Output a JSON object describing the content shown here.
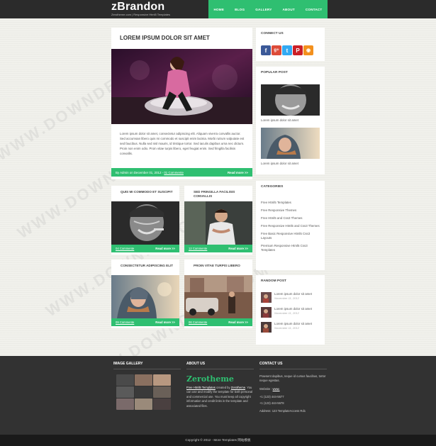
{
  "header": {
    "logo": "zBrandon",
    "tagline": "Zerotheme.com | Responsive Html5 Templates",
    "nav": [
      "HOME",
      "BLOG",
      "GALLERY",
      "ABOUT",
      "CONTACT"
    ]
  },
  "main_post": {
    "title": "LOREM IPSUM DOLOR SIT AMET",
    "image": "woman-on-car-photo",
    "text": "Lorem ipsum dolor sit amet, consectetur adipiscing elit. Aliquam viverra convallis auctor. Sed accumsan libero quis mi commodo et suscipit enim lacinia. Morbi rutrum vulputate est sed faucibus. Nulla sed nisl mauris, id tristique tortor. Sed iaculis dapibus urna nec dictum. Proin non enim odio. Proin vitae turpis libero, eget feugiat enim. Sed fringilla facilisis convallis.",
    "meta_prefix": "By Admin on December 01, 2012 - ",
    "comments": "01 Commente",
    "readmore": "Read more >>"
  },
  "small_posts": [
    {
      "title": "QUIS MI COMMODO ET SUSCIPIT",
      "comments": "04 Commente",
      "readmore": "Read more >>"
    },
    {
      "title": "SED FRINGILLA FACILISIS CONVALLIS",
      "comments": "12 Commente",
      "readmore": "Read more >>"
    },
    {
      "title": "CONSECTETUR ADIPISCING ELIT",
      "comments": "09 Commente",
      "readmore": "Read more >>"
    },
    {
      "title": "PROIN VITAE TURPIS LIBERO",
      "comments": "06 Commente",
      "readmore": "Read more >>"
    }
  ],
  "sidebar": {
    "connect_title": "CONNECT US",
    "social": [
      {
        "icon": "facebook-icon",
        "glyph": "f",
        "color": "#3b5998"
      },
      {
        "icon": "googleplus-icon",
        "glyph": "g+",
        "color": "#dd4b39"
      },
      {
        "icon": "twitter-icon",
        "glyph": "t",
        "color": "#33aaf3"
      },
      {
        "icon": "pinterest-icon",
        "glyph": "P",
        "color": "#cb2027"
      },
      {
        "icon": "rss-icon",
        "glyph": "◉",
        "color": "#f3901d"
      }
    ],
    "popular_title": "POPULAR POST",
    "popular_captions": [
      "Lorem ipsum dolor sit amet",
      "Lorem ipsum dolor sit amet"
    ],
    "categories_title": "CATEGORIES",
    "categories": [
      "Free Html5 Templates",
      "Free Responsive Themes",
      "Free Html5 and Css3 Themes",
      "Free Responsive Html5 and Css3 Themes",
      "Free Basic Responsive Html5 Css3 Layouts",
      "Premium Responsive Html5 Css3 Templates"
    ],
    "random_title": "RANDOM POST",
    "random_posts": [
      {
        "title": "Lorem ipsum dolor sit amet",
        "date": "November 11, 2012"
      },
      {
        "title": "Lorem ipsum dolor sit amet",
        "date": "November 11, 2012"
      },
      {
        "title": "Lorem ipsum dolor sit amet",
        "date": "November 11, 2012"
      }
    ]
  },
  "footer": {
    "gallery_title": "IMAGE GALLERY",
    "about_title": "ABOUT US",
    "about_brand": "Zerotheme",
    "about_link": "Free Html5 Templates",
    "about_text_1": " created by ",
    "about_author": "Zerotheme",
    "about_text_2": ". You can use and modify the template for both personal and commercial use. You must keep all copyright information and credit links in the template and associated files.",
    "contact_title": "CONTACT US",
    "contact_intro": "Praesent dapibus, neque id cursus faucibus, tortor neque egestas.",
    "website_label": "Website : ",
    "website": "www.",
    "phone1": "+1 (123) 444-5677",
    "phone2": "+1 (123) 444-5678",
    "address": "Address: 123 TemplateAccess Rd1"
  },
  "copyright": "Copyright © 2012 - More Templates 网站模板",
  "watermark": "WWW.DOWNDEMO.COM"
}
